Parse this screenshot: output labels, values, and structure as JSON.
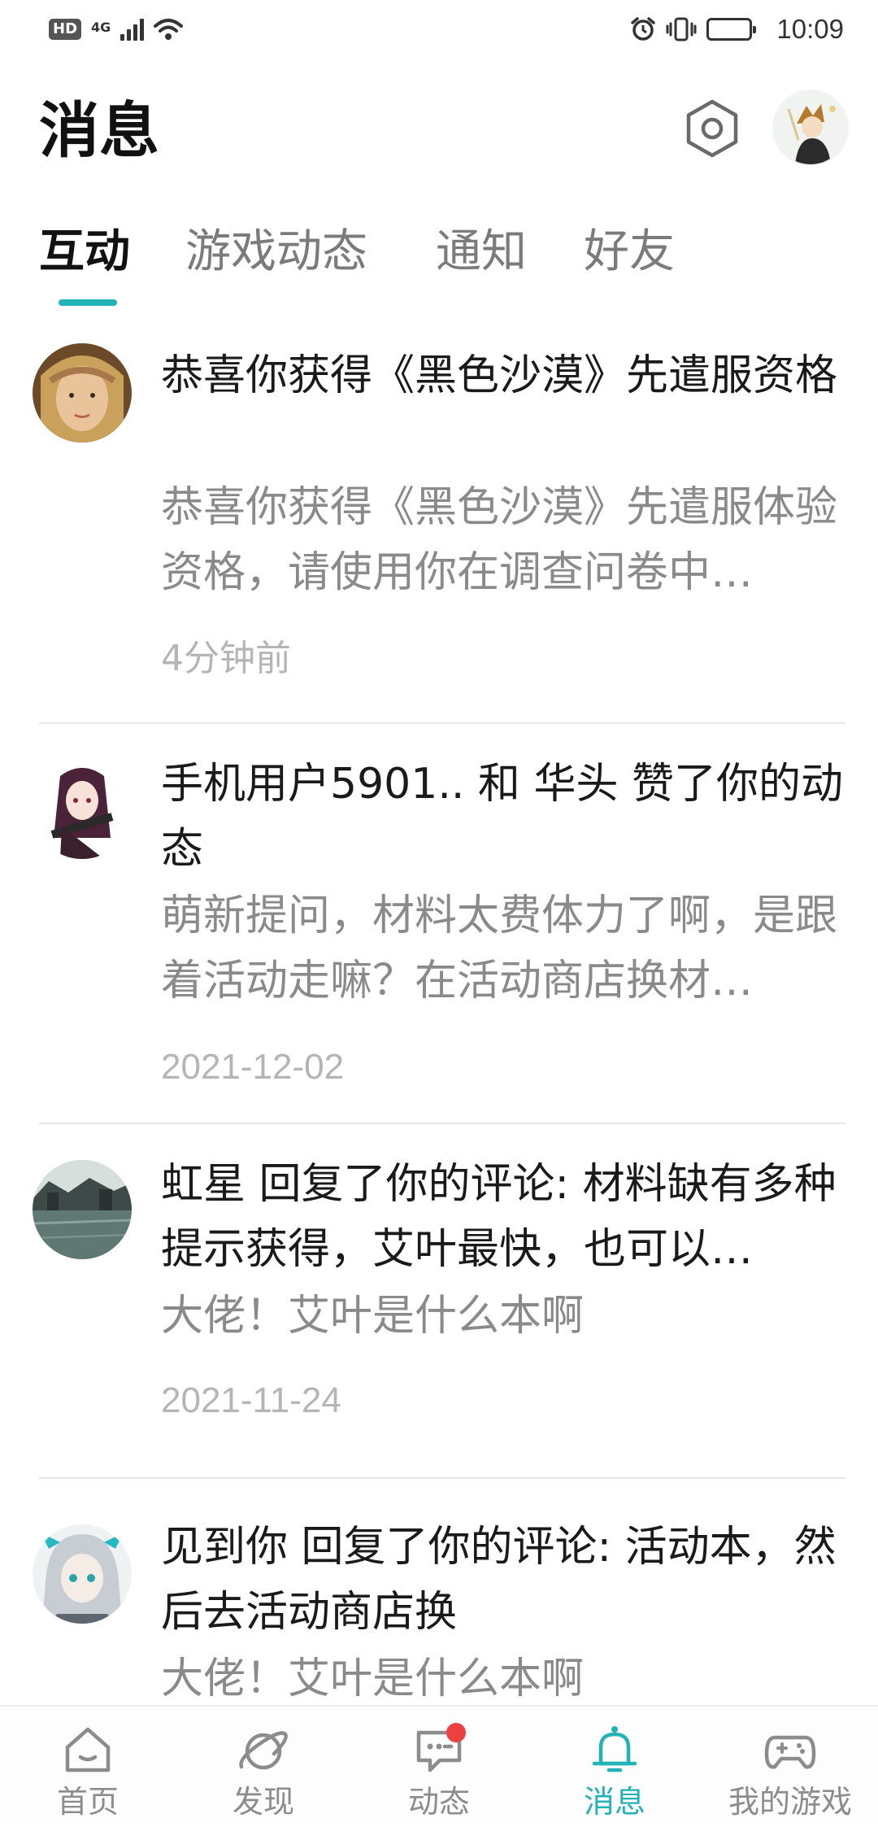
{
  "status_bar": {
    "hd": "HD",
    "network": "4G",
    "time": "10:09"
  },
  "header": {
    "title": "消息"
  },
  "tabs": [
    {
      "label": "互动",
      "active": true
    },
    {
      "label": "游戏动态",
      "active": false
    },
    {
      "label": "通知",
      "active": false
    },
    {
      "label": "好友",
      "active": false
    }
  ],
  "messages": [
    {
      "title": "恭喜你获得《黑色沙漠》先遣服资格",
      "body": "恭喜你获得《黑色沙漠》先遣服体验资格，请使用你在调查问卷中…",
      "time": "4分钟前"
    },
    {
      "title": "手机用户5901.. 和 华头 赞了你的动态",
      "body": "萌新提问，材料太费体力了啊，是跟着活动走嘛？在活动商店换材…",
      "time": "2021-12-02"
    },
    {
      "title": "虹星 回复了你的评论: 材料缺有多种提示获得，艾叶最快，也可以…",
      "body": "大佬！艾叶是什么本啊",
      "time": "2021-11-24"
    },
    {
      "title": "见到你 回复了你的评论: 活动本，然后去活动商店换",
      "body": "大佬！艾叶是什么本啊",
      "time": ""
    }
  ],
  "bottom_nav": [
    {
      "label": "首页",
      "icon": "home-icon",
      "active": false
    },
    {
      "label": "发现",
      "icon": "planet-icon",
      "active": false
    },
    {
      "label": "动态",
      "icon": "chat-icon",
      "active": false,
      "badge": true
    },
    {
      "label": "消息",
      "icon": "bell-icon",
      "active": true
    },
    {
      "label": "我的游戏",
      "icon": "gamepad-icon",
      "active": false
    }
  ],
  "colors": {
    "accent": "#22b3b6",
    "badge": "#ee4040",
    "secondary_text": "#8a8a8a",
    "time_text": "#b5b5b5"
  }
}
